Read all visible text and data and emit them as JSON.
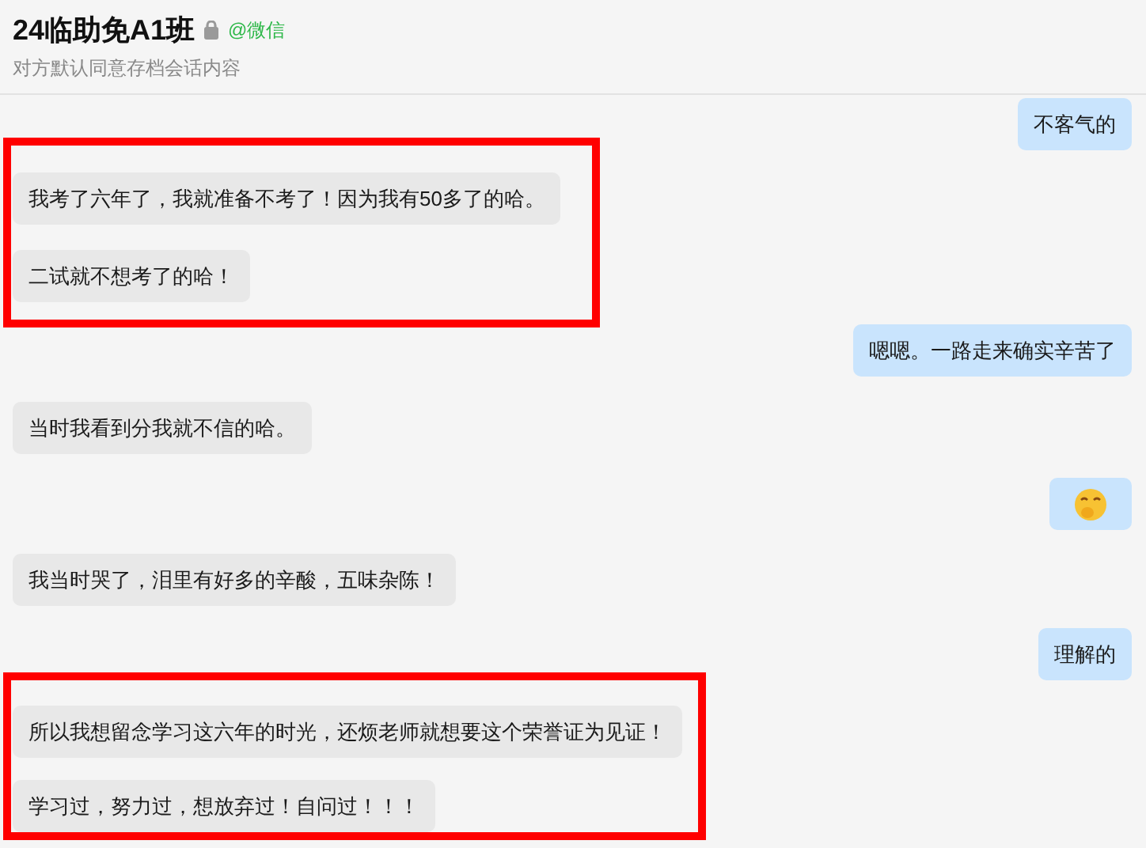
{
  "header": {
    "title": "24临助免A1班",
    "source": "@微信",
    "subtitle": "对方默认同意存档会话内容"
  },
  "items": [
    {
      "kind": "message",
      "outgoing": true,
      "text": "不客气的"
    },
    {
      "kind": "highlight",
      "messages": [
        {
          "kind": "message",
          "outgoing": false,
          "text": "我考了六年了，我就准备不考了！因为我有50多了的哈。"
        },
        {
          "kind": "message",
          "outgoing": false,
          "text": "二试就不想考了的哈！"
        }
      ]
    },
    {
      "kind": "message",
      "outgoing": true,
      "text": "嗯嗯。一路走来确实辛苦了"
    },
    {
      "kind": "message",
      "outgoing": false,
      "text": "当时我看到分我就不信的哈。"
    },
    {
      "kind": "sticker",
      "outgoing": true
    },
    {
      "kind": "message",
      "outgoing": false,
      "text": "我当时哭了，泪里有好多的辛酸，五味杂陈！"
    },
    {
      "kind": "message",
      "outgoing": true,
      "text": "理解的"
    },
    {
      "kind": "highlight",
      "messages": [
        {
          "kind": "message",
          "outgoing": false,
          "text": "所以我想留念学习这六年的时光，还烦老师就想要这个荣誉证为见证！"
        },
        {
          "kind": "message",
          "outgoing": false,
          "text": "学习过，努力过，想放弃过！自问过！！！"
        }
      ]
    }
  ]
}
